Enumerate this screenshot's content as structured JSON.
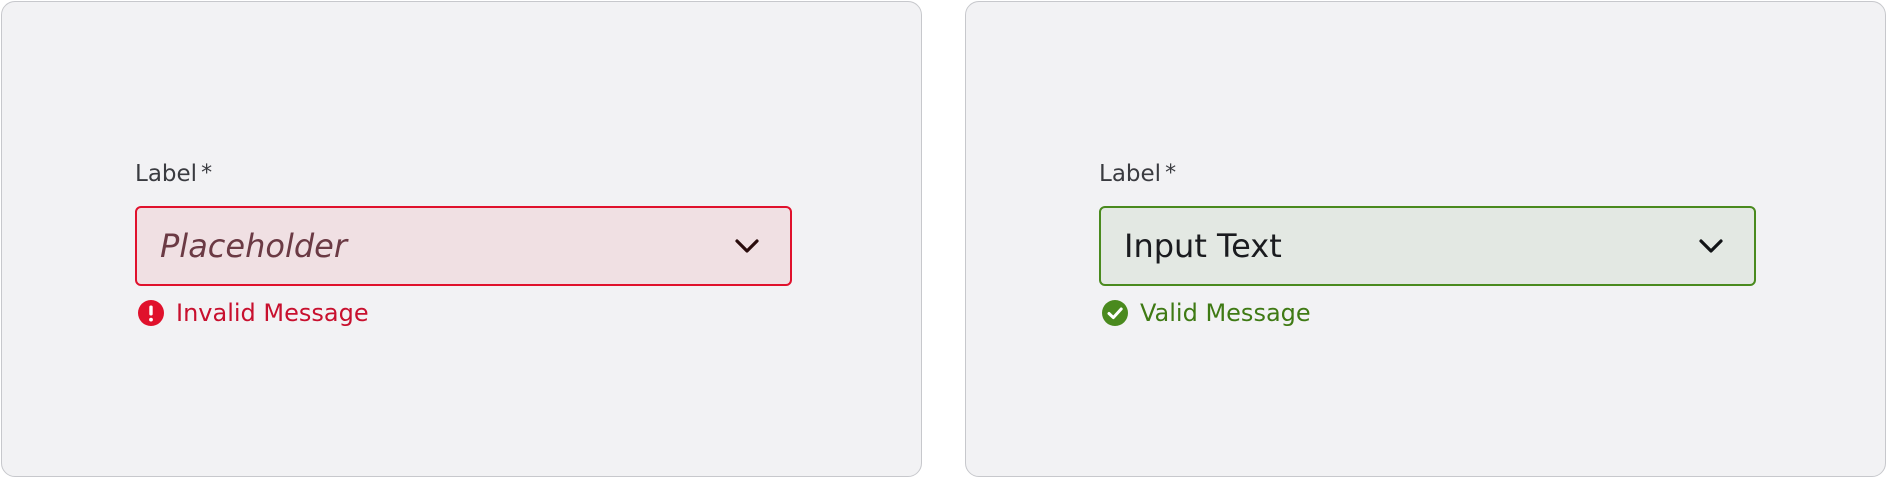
{
  "colors": {
    "invalid_border": "#e0112c",
    "invalid_bg": "#f0e0e3",
    "invalid_text": "#c8102e",
    "valid_border": "#4a8a1e",
    "valid_bg": "#e3e8e3",
    "valid_text": "#3f7a14",
    "panel_bg": "#f2f2f4"
  },
  "invalid_field": {
    "label": "Label",
    "required_marker": "*",
    "placeholder": "Placeholder",
    "chevron_icon": "chevron-down-icon",
    "message_icon": "error-exclamation-icon",
    "message": "Invalid Message"
  },
  "valid_field": {
    "label": "Label",
    "required_marker": "*",
    "value": "Input Text",
    "chevron_icon": "chevron-down-icon",
    "message_icon": "check-circle-icon",
    "message": "Valid Message"
  }
}
